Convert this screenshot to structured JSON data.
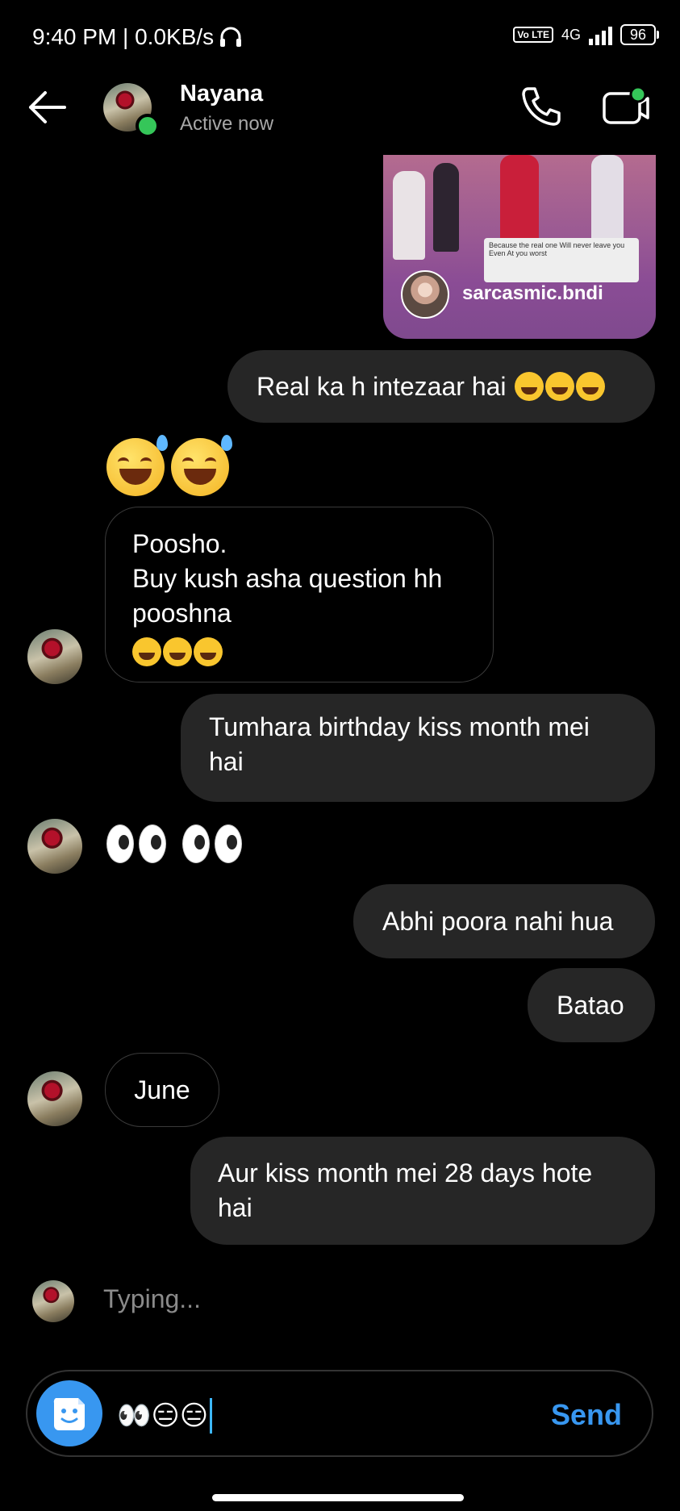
{
  "status_bar": {
    "time_speed": "9:40 PM | 0.0KB/s",
    "volte": "Vo LTE",
    "network": "4G",
    "battery": "96"
  },
  "header": {
    "name": "Nayana",
    "status": "Active now",
    "online_color": "#35c659"
  },
  "messages": {
    "shared_post": {
      "account": "sarcasmic.bndi",
      "caption": "Because the real one Will never leave you Even At you worst"
    },
    "m1": {
      "text": "Real ka h intezaar hai"
    },
    "m3": {
      "line1": "Poosho.",
      "line2": "Buy kush asha question hh",
      "line3": "pooshna"
    },
    "m4": {
      "line1": "Tumhara birthday kiss month mei",
      "line2": "hai"
    },
    "m6": {
      "text": "Abhi poora nahi hua"
    },
    "m7": {
      "text": "Batao"
    },
    "m8": {
      "text": "June"
    },
    "m9": {
      "line1": "Aur kiss month mei 28 days hote",
      "line2": "hai"
    }
  },
  "typing_indicator": "Typing...",
  "composer": {
    "value": "👀😑😑",
    "send_label": "Send",
    "accent": "#3897f0"
  },
  "icons": [
    "back-arrow-icon",
    "phone-icon",
    "video-call-icon",
    "sticker-icon",
    "headphones-icon",
    "signal-icon",
    "battery-icon"
  ]
}
